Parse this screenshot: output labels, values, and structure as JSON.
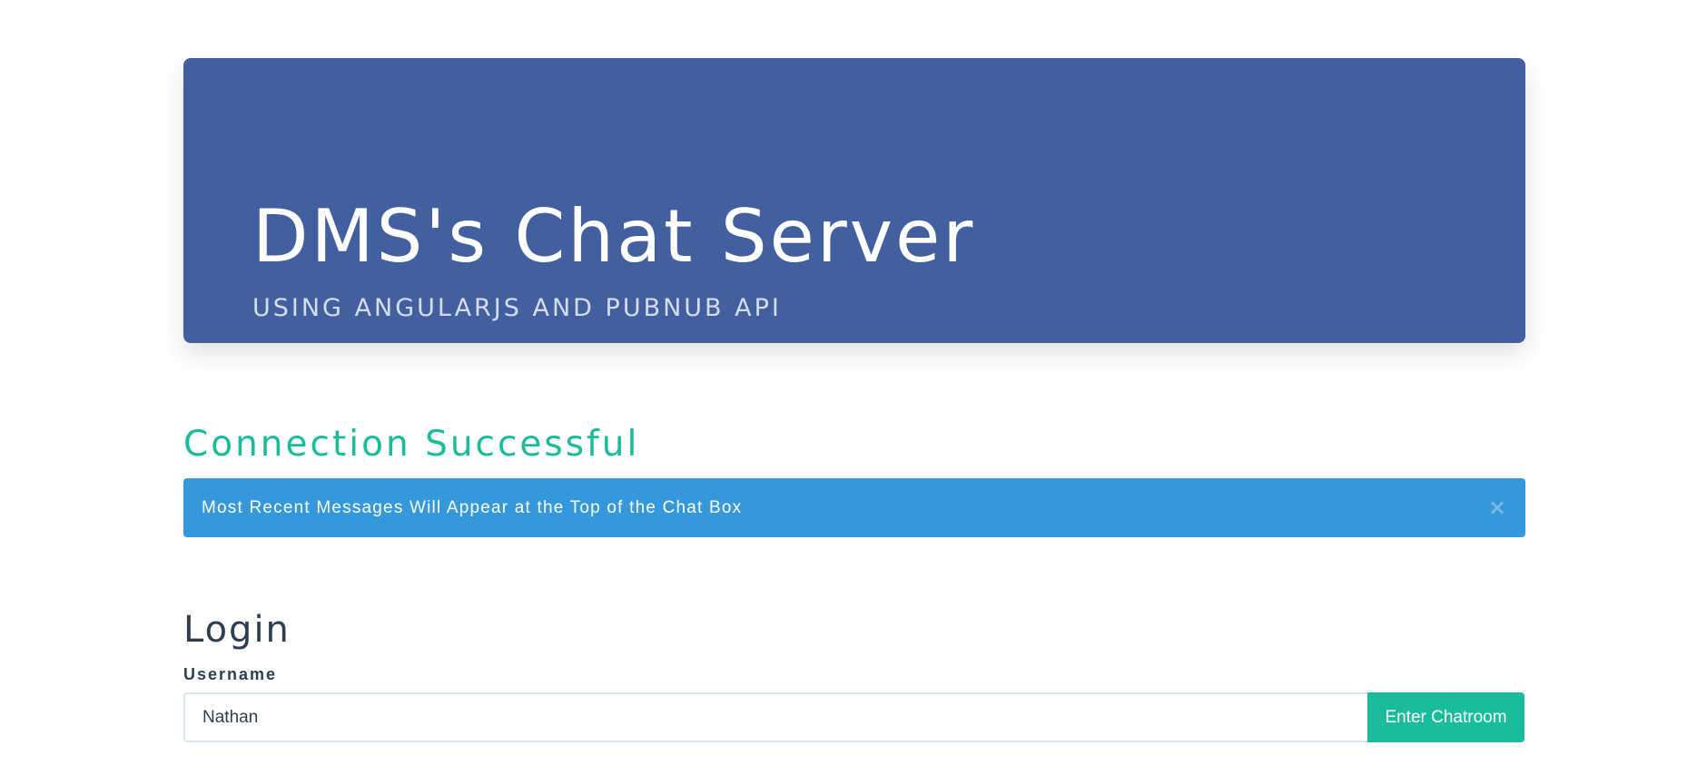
{
  "header": {
    "title": "DMS's Chat Server",
    "subtitle": "USING ANGULARJS AND PUBNUB API"
  },
  "status": {
    "heading": "Connection Successful",
    "alert_text": "Most Recent Messages Will Appear at the Top of the Chat Box",
    "close_glyph": "×"
  },
  "login": {
    "heading": "Login",
    "username_label": "Username",
    "username_value": "Nathan",
    "enter_button_label": "Enter Chatroom"
  },
  "colors": {
    "jumbotron_bg": "#4260a0",
    "accent_teal": "#1abc9c",
    "alert_blue": "#3498db",
    "text_dark": "#2c3e50"
  },
  "icons": {
    "alert_close": "close-icon"
  }
}
